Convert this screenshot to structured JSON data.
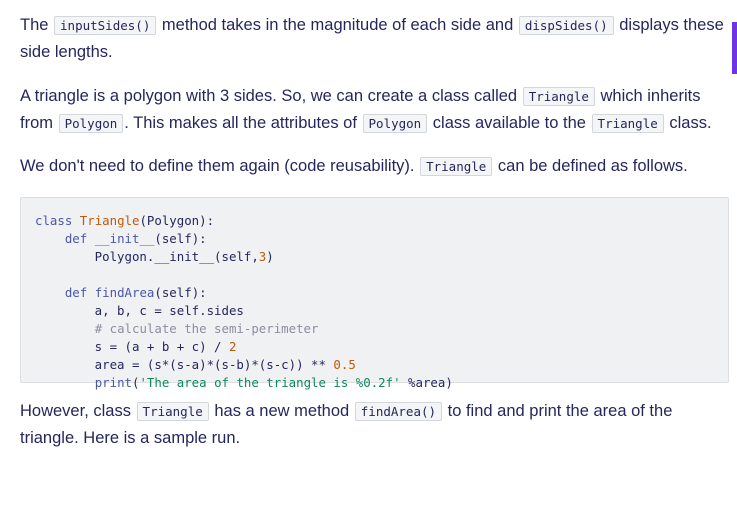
{
  "paragraphs": {
    "p1": {
      "code1": "inputSides()",
      "text1": " method takes in the magnitude of each side and ",
      "code2": "dispSides()",
      "text2": " displays these side lengths.",
      "lead": "The "
    },
    "p2": {
      "text1": "A triangle is a polygon with 3 sides. So, we can create a class called ",
      "code1": "Triangle",
      "text2": " which inherits from ",
      "code2": "Polygon",
      "text3": ". This makes all the attributes of ",
      "code3": "Polygon",
      "text4": " class available to the ",
      "code4": "Triangle",
      "text5": " class."
    },
    "p3": {
      "text1": "We don't need to define them again (code reusability). ",
      "code1": "Triangle",
      "text2": " can be defined as follows."
    },
    "p5": {
      "text1": "However, class ",
      "code1": "Triangle",
      "text2": " has a new method ",
      "code2": "findArea()",
      "text3": " to find and print the area of the triangle. Here is a sample run."
    }
  },
  "code_block": {
    "lines": [
      "class Triangle(Polygon):",
      "    def __init__(self):",
      "        Polygon.__init__(self,3)",
      "",
      "    def findArea(self):",
      "        a, b, c = self.sides",
      "        # calculate the semi-perimeter",
      "        s = (a + b + c) / 2",
      "        area = (s*(s-a)*(s-b)*(s-c)) ** 0.5",
      "        print('The area of the triangle is %0.2f' %area)"
    ]
  },
  "colors": {
    "text": "#25265e",
    "accent": "#6d34e8",
    "code_bg": "#f0f1f3"
  }
}
